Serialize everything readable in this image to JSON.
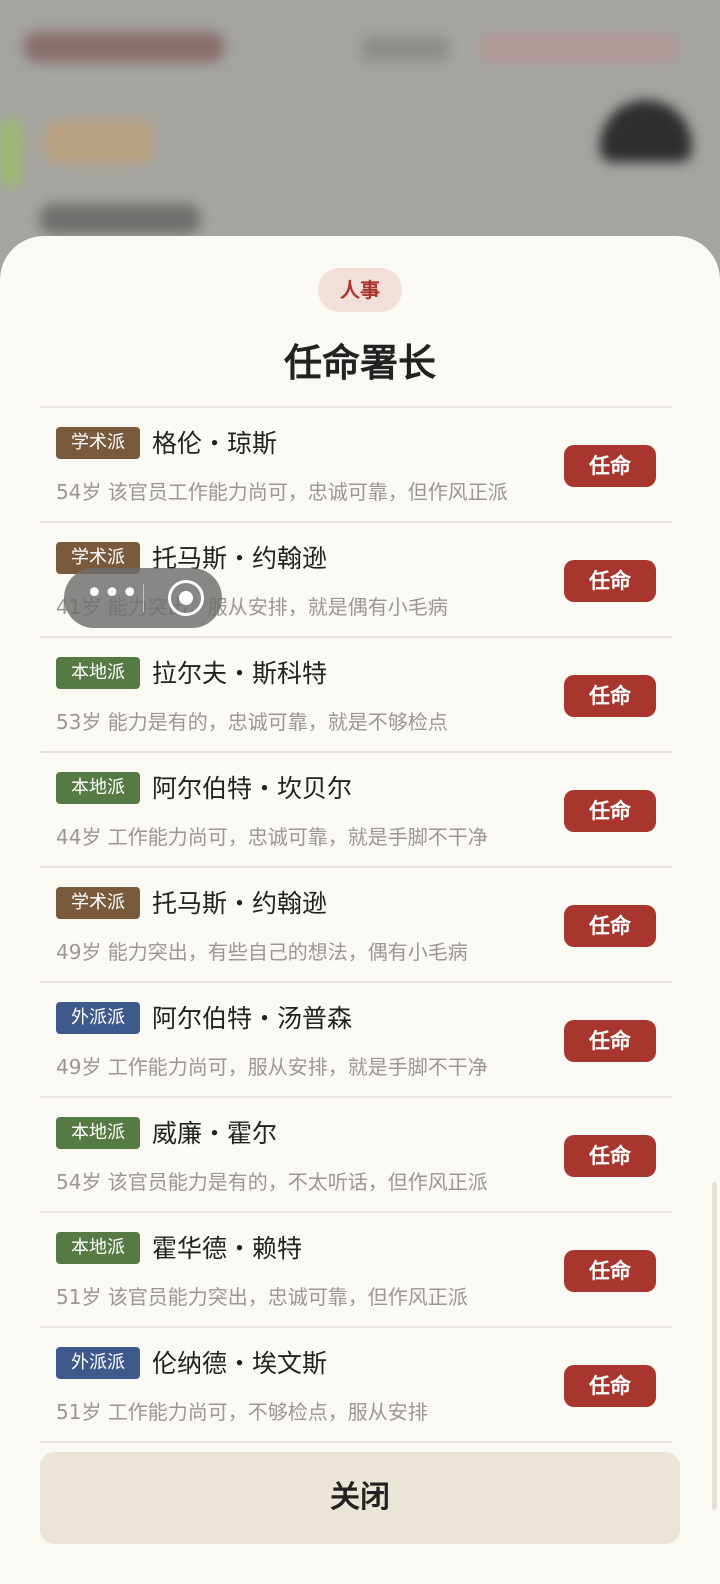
{
  "sheet": {
    "category_tag": "人事",
    "title": "任命署长",
    "close_label": "关闭"
  },
  "colors": {
    "academic": "#7a5a3c",
    "local": "#567a44",
    "foreign": "#3e5a8c",
    "action": "#a8362e"
  },
  "candidates": [
    {
      "faction": "学术派",
      "faction_key": "academic",
      "name": "格伦・琼斯",
      "desc": "54岁 该官员工作能力尚可，忠诚可靠，但作风正派",
      "action": "任命"
    },
    {
      "faction": "学术派",
      "faction_key": "academic",
      "name": "托马斯・约翰逊",
      "desc": "41岁 能力突出，服从安排，就是偶有小毛病",
      "action": "任命"
    },
    {
      "faction": "本地派",
      "faction_key": "local",
      "name": "拉尔夫・斯科特",
      "desc": "53岁 能力是有的，忠诚可靠，就是不够检点",
      "action": "任命"
    },
    {
      "faction": "本地派",
      "faction_key": "local",
      "name": "阿尔伯特・坎贝尔",
      "desc": "44岁 工作能力尚可，忠诚可靠，就是手脚不干净",
      "action": "任命"
    },
    {
      "faction": "学术派",
      "faction_key": "academic",
      "name": "托马斯・约翰逊",
      "desc": "49岁 能力突出，有些自己的想法，偶有小毛病",
      "action": "任命"
    },
    {
      "faction": "外派派",
      "faction_key": "foreign",
      "name": "阿尔伯特・汤普森",
      "desc": "49岁 工作能力尚可，服从安排，就是手脚不干净",
      "action": "任命"
    },
    {
      "faction": "本地派",
      "faction_key": "local",
      "name": "威廉・霍尔",
      "desc": "54岁 该官员能力是有的，不太听话，但作风正派",
      "action": "任命"
    },
    {
      "faction": "本地派",
      "faction_key": "local",
      "name": "霍华德・赖特",
      "desc": "51岁 该官员能力突出，忠诚可靠，但作风正派",
      "action": "任命"
    },
    {
      "faction": "外派派",
      "faction_key": "foreign",
      "name": "伦纳德・埃文斯",
      "desc": "51岁 工作能力尚可，不够检点，服从安排",
      "action": "任命"
    }
  ],
  "capsule": {
    "more_icon": "more-dots-icon",
    "close_icon": "target-circle-icon"
  }
}
